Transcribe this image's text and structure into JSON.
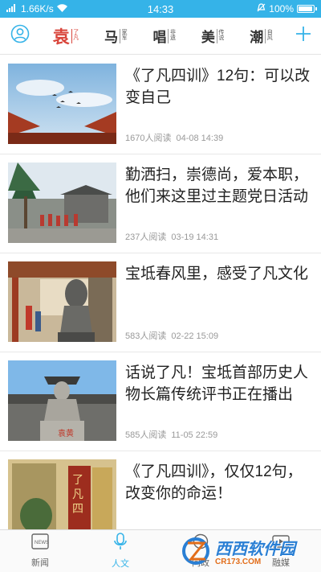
{
  "status_bar": {
    "carrier": "然ill",
    "speed": "1.66K/s",
    "time": "14:33",
    "battery": "100%",
    "battery_level": 1.0
  },
  "top_nav": {
    "user_icon": "user-icon",
    "add_icon": "plus-icon",
    "tabs": [
      {
        "big": "袁",
        "small": "了凡",
        "active": true
      },
      {
        "big": "马",
        "small": "家军",
        "active": false
      },
      {
        "big": "唱",
        "small": "非遗",
        "active": false
      },
      {
        "big": "美",
        "small": "传说",
        "active": false
      },
      {
        "big": "潮",
        "small": "自风",
        "active": false
      }
    ]
  },
  "feed": {
    "items": [
      {
        "title": "《了凡四训》12句：可以改变自己",
        "reads": "1670人阅读",
        "date": "04-08 14:39"
      },
      {
        "title": "勤洒扫，崇德尚，爱本职，他们来这里过主题党日活动",
        "reads": "237人阅读",
        "date": "03-19 14:31"
      },
      {
        "title": "宝坻春风里，感受了凡文化",
        "reads": "583人阅读",
        "date": "02-22 15:09"
      },
      {
        "title": "话说了凡！宝坻首部历史人物长篇传统评书正在播出",
        "reads": "585人阅读",
        "date": "11-05 22:59"
      },
      {
        "title": "《了凡四训》，仅仅12句，改变你的命运！",
        "reads": "",
        "date": ""
      }
    ]
  },
  "bottom_bar": {
    "items": [
      {
        "label": "新闻",
        "icon": "news-icon",
        "active": false
      },
      {
        "label": "人文",
        "icon": "microphone-icon",
        "active": true
      },
      {
        "label": "问政",
        "icon": "question-icon",
        "active": false
      },
      {
        "label": "融媒",
        "icon": "media-icon",
        "active": false
      }
    ]
  },
  "watermark": {
    "main": "西西软件园",
    "sub": "CR173.COM"
  },
  "colors": {
    "accent": "#35b3e8",
    "active_tab": "#d9453b",
    "meta": "#999999"
  }
}
